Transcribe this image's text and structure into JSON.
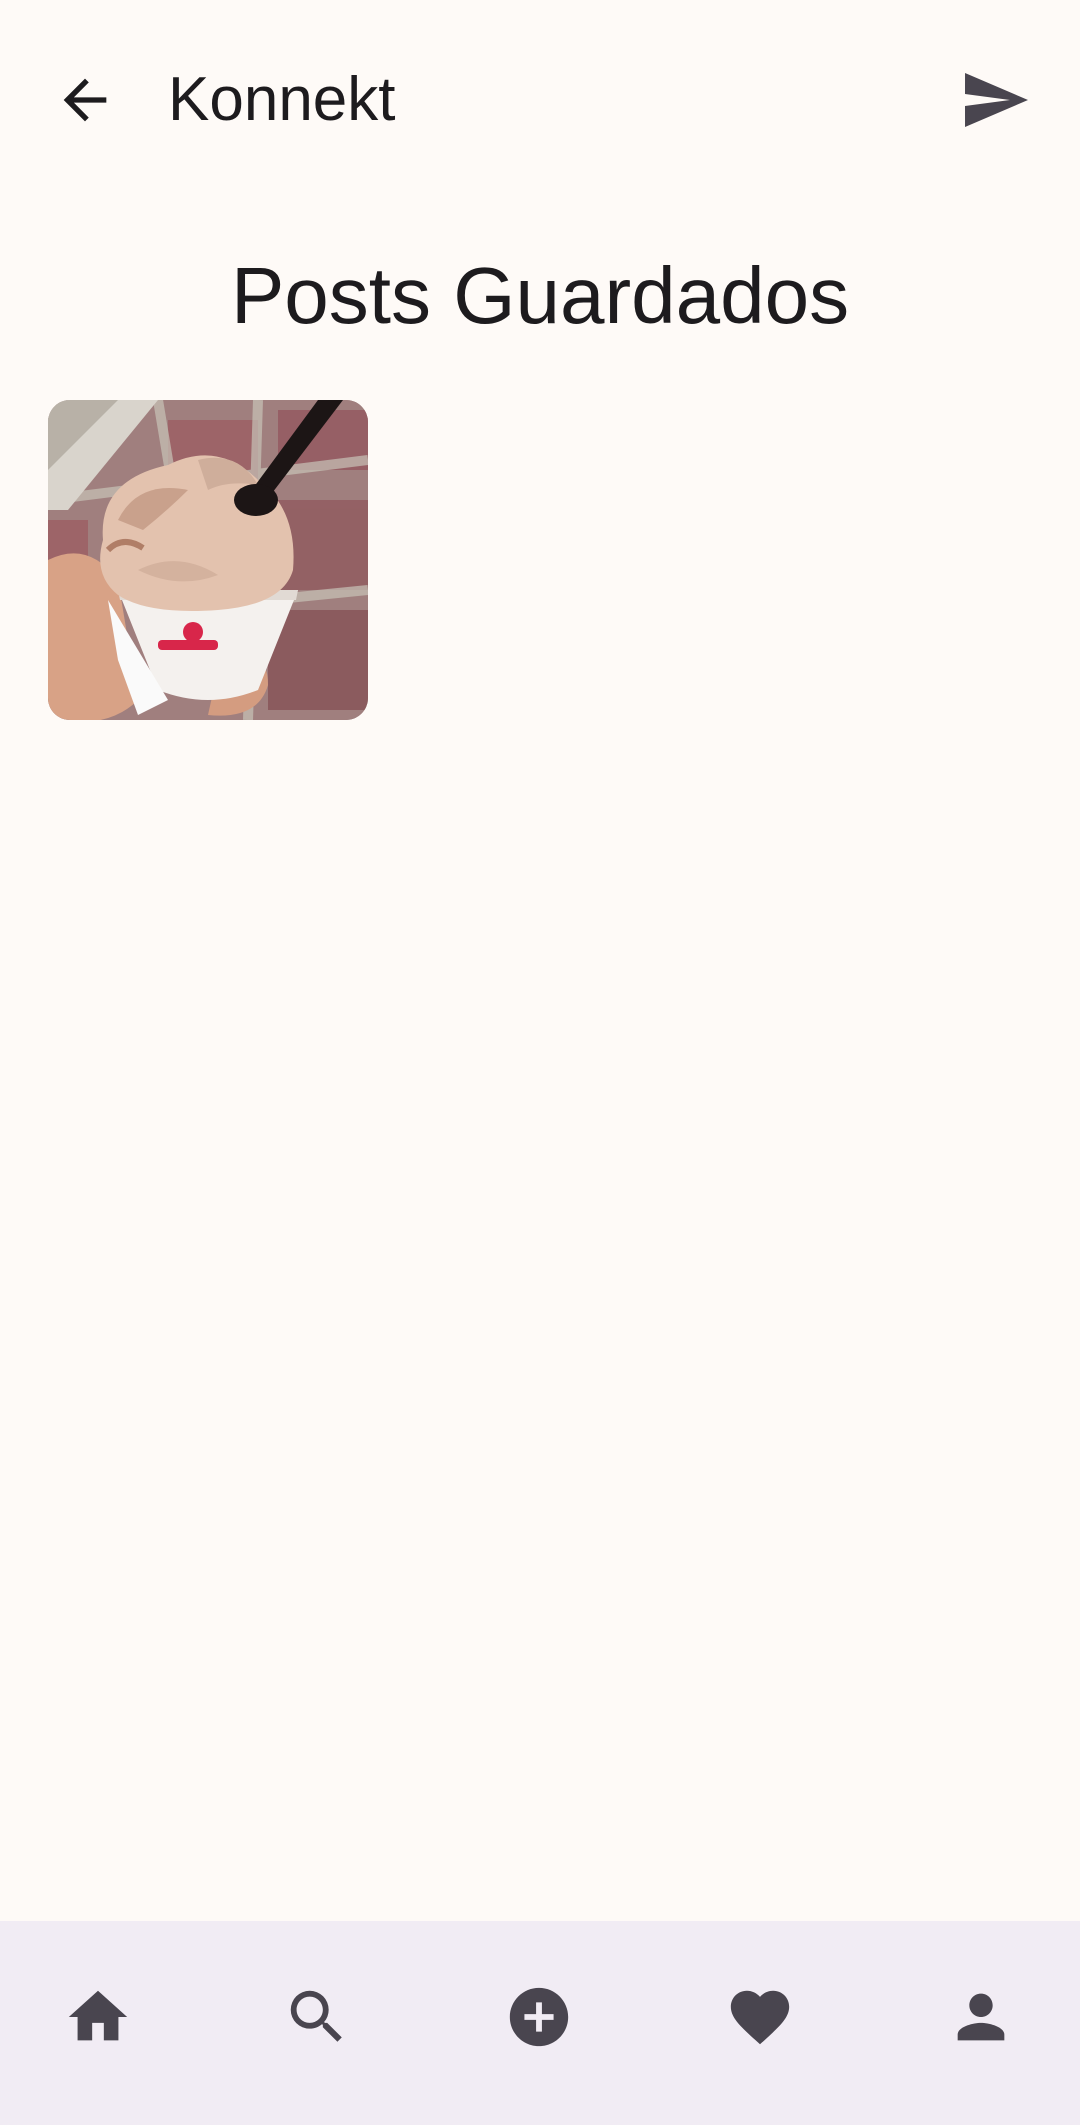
{
  "app_bar": {
    "title": "Konnekt",
    "back_icon": "arrow-back-icon",
    "send_icon": "send-icon"
  },
  "page": {
    "title": "Posts Guardados"
  },
  "saved_posts": [
    {
      "image": "ice-cream-cup-photo"
    }
  ],
  "bottom_nav": {
    "items": [
      {
        "icon": "home-icon"
      },
      {
        "icon": "search-icon"
      },
      {
        "icon": "add-circle-icon"
      },
      {
        "icon": "heart-icon"
      },
      {
        "icon": "person-icon"
      }
    ]
  },
  "colors": {
    "background": "#FEFAF7",
    "nav_background": "#F1ECF4",
    "icon": "#49454F",
    "text": "#1D1B1E"
  }
}
